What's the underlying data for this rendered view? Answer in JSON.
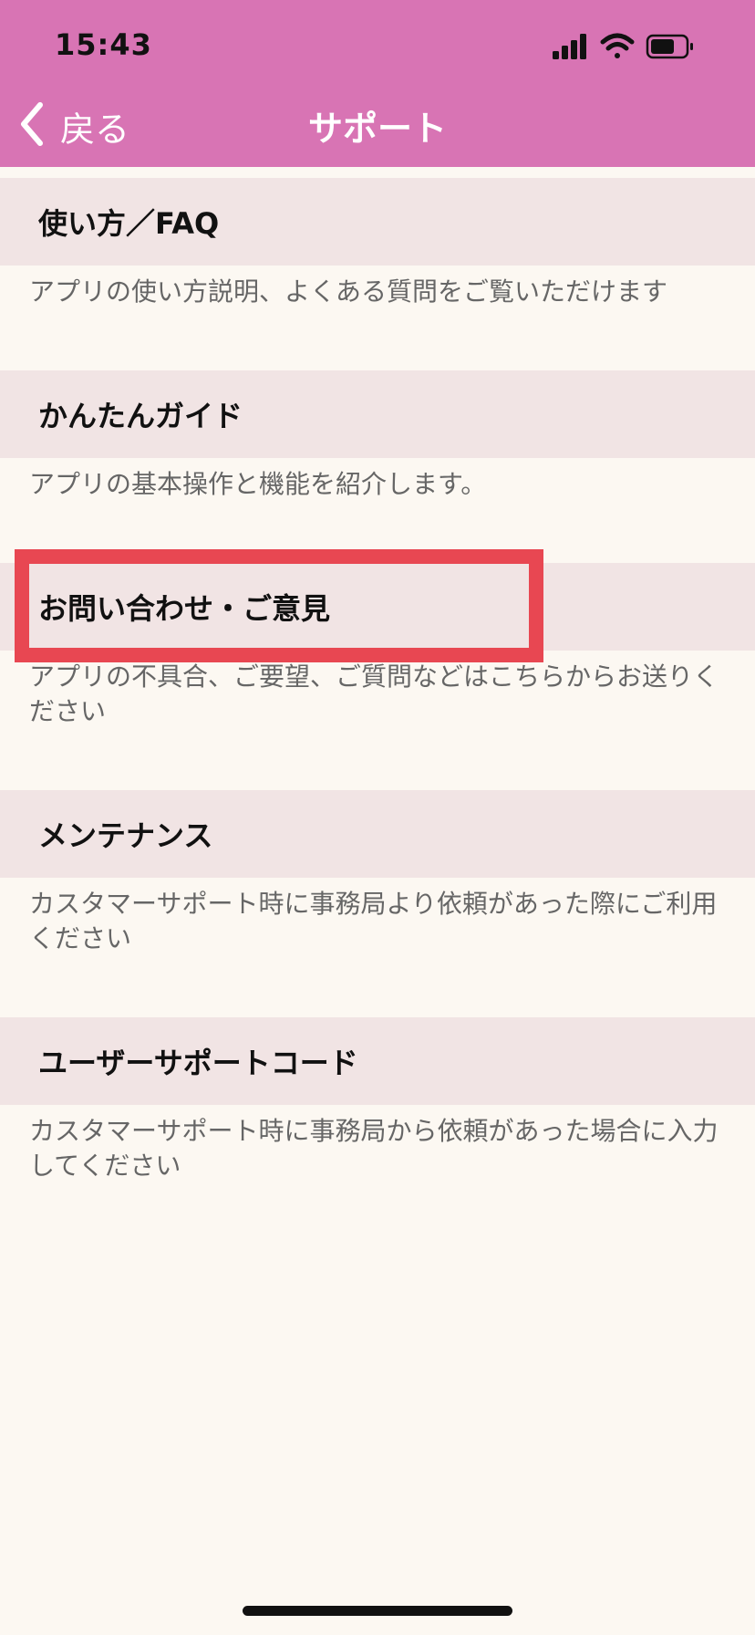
{
  "status_bar": {
    "time": "15:43"
  },
  "nav": {
    "back_label": "戻る",
    "title": "サポート"
  },
  "sections": [
    {
      "title": "使い方／FAQ",
      "description": "アプリの使い方説明、よくある質問をご覧いただけます"
    },
    {
      "title": "かんたんガイド",
      "description": "アプリの基本操作と機能を紹介します。"
    },
    {
      "title": "お問い合わせ・ご意見",
      "description": "アプリの不具合、ご要望、ご質問などはこちらからお送りください"
    },
    {
      "title": "メンテナンス",
      "description": "カスタマーサポート時に事務局より依頼があった際にご利用ください"
    },
    {
      "title": "ユーザーサポートコード",
      "description": "カスタマーサポート時に事務局から依頼があった場合に入力してください"
    }
  ],
  "colors": {
    "header": "#D874B4",
    "section_header_bg": "#F1E4E4",
    "background": "#FCF8F2",
    "highlight": "#E84752"
  },
  "icons": {
    "back": "chevron-left-icon",
    "signal": "cellular-signal-icon",
    "wifi": "wifi-icon",
    "battery": "battery-icon"
  }
}
